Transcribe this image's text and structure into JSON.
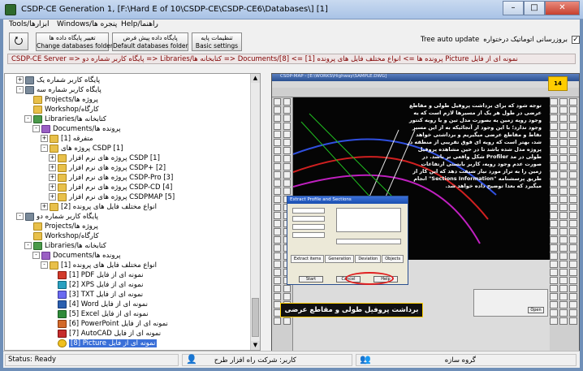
{
  "window": {
    "title": "CSDP-CE Generation 1, [F:\\Hard E of 10\\CSDP-CE\\CSDP-CE6\\Databases\\] [1]",
    "min_label": "–",
    "max_label": "□",
    "close_label": "✕"
  },
  "menu": {
    "items": [
      "Tools/ابزارها",
      "Windows/پنجره ها",
      "Help/راهنما"
    ]
  },
  "toolbar": {
    "icon_button": "⭮",
    "buttons": [
      {
        "line1": "تغییر پایگاه داده ها",
        "line2": "Change databases folder"
      },
      {
        "line1": "پایگاه داده پیش فرض",
        "line2": "Default databases folder"
      },
      {
        "line1": "تنظیمات پایه",
        "line2": "Basic settings"
      }
    ],
    "tree_auto_update_label": "Tree auto update",
    "tree_auto_update_check": "✓",
    "auto_update_label": "بروزرسانی اتوماتیک درختواره",
    "auto_update_check": "✓"
  },
  "path_text": "CSDP-CE Server => پایگاه کاربر شماره دو => Libraries/کتابخانه ها => Documents/پرونده ها => انواع مختلف فایل های پرونده [1] => [8] Picture نمونه ای از فایل",
  "tree": [
    {
      "label": "پایگاه کاربر شماره یک",
      "expander": "+",
      "icon": "server",
      "indent": 2
    },
    {
      "label": "پایگاه کاربر شماره سه",
      "expander": "-",
      "icon": "server",
      "indent": 2
    },
    {
      "label": "Projects/پروژه ها",
      "expander": "",
      "icon": "folder",
      "indent": 3
    },
    {
      "label": "Workshop/کارگاه",
      "expander": "",
      "icon": "folder",
      "indent": 3
    },
    {
      "label": "Libraries/کتابخانه ها",
      "expander": "-",
      "icon": "lib",
      "indent": 3
    },
    {
      "label": "Documents/پرونده ها",
      "expander": "-",
      "icon": "purple",
      "indent": 4
    },
    {
      "label": "متفرقه [1]",
      "expander": "+",
      "icon": "folder",
      "indent": 5
    },
    {
      "label": "پروژه های CSDP [1]",
      "expander": "-",
      "icon": "folder",
      "indent": 5
    },
    {
      "label": "پروژه های نرم افزار CSDP [1]",
      "expander": "+",
      "icon": "folder",
      "indent": 6
    },
    {
      "label": "پروژه های نرم افزار CSDP+ [2]",
      "expander": "+",
      "icon": "folder",
      "indent": 6
    },
    {
      "label": "پروژه های نرم افزار CSDP-Pro [3]",
      "expander": "+",
      "icon": "folder",
      "indent": 6
    },
    {
      "label": "پروژه های نرم افزار CSDP-CD [4]",
      "expander": "+",
      "icon": "folder",
      "indent": 6
    },
    {
      "label": "پروژه های نرم افزار CSDPMAP [5]",
      "expander": "+",
      "icon": "folder",
      "indent": 6
    },
    {
      "label": "انواع مختلف فایل های پرونده [2]",
      "expander": "+",
      "icon": "folder",
      "indent": 5
    },
    {
      "label": "پایگاه کاربر شماره دو",
      "expander": "-",
      "icon": "server",
      "indent": 2
    },
    {
      "label": "Projects/پروژه ها",
      "expander": "",
      "icon": "folder",
      "indent": 3
    },
    {
      "label": "Workshop/کارگاه",
      "expander": "",
      "icon": "folder",
      "indent": 3
    },
    {
      "label": "Libraries/کتابخانه ها",
      "expander": "-",
      "icon": "lib",
      "indent": 3
    },
    {
      "label": "Documents/پرونده ها",
      "expander": "-",
      "icon": "purple",
      "indent": 4
    },
    {
      "label": "انواع مختلف فایل های پرونده [1]",
      "expander": "-",
      "icon": "folder",
      "indent": 5
    },
    {
      "label": "[1] PDF نمونه ای از فایل",
      "expander": "",
      "icon": "pdf",
      "indent": 6
    },
    {
      "label": "[2] XPS نمونه ای از فایل",
      "expander": "",
      "icon": "xps",
      "indent": 6
    },
    {
      "label": "[3] TXT نمونه ای از فایل",
      "expander": "",
      "icon": "txt",
      "indent": 6
    },
    {
      "label": "[4] Word نمونه ای از فایل",
      "expander": "",
      "icon": "word",
      "indent": 6
    },
    {
      "label": "[5] Excel نمونه ای از فایل",
      "expander": "",
      "icon": "excel",
      "indent": 6
    },
    {
      "label": "[6] PowerPoint نمونه ای از فایل",
      "expander": "",
      "icon": "ppt",
      "indent": 6
    },
    {
      "label": "[7] AutoCAD نمونه ای از فایل",
      "expander": "",
      "icon": "cad",
      "indent": 6
    },
    {
      "label": "[8] Picture نمونه ای از فایل",
      "expander": "",
      "icon": "pic",
      "indent": 6,
      "selected": true
    }
  ],
  "preview": {
    "badge": "14",
    "description": "توجه شود که برای برداشت پروفیل طولی و مقاطع عرضی در طول هر یک از مسیرها لازم است که یه وجود رویه زمین یه بصورت مدل تین و یا رویه کنتور وجود ندارد؛ با این وجود از آنجائیکه به از این مسیر نقاط و مقاطع عرضی میگیریم و برداشتی خواهد شد، بهتر است که رویه ای فوق تقریبی از منطقه در پروژه مدل شده باشد تا در حین مشاهده پروفیل طولی در مد Profiler شکل واقعی تر باشد. در صورت عدم وجود رویه، کاربر بایستی ارتفاعات زمین را به تراز مورد نیاز شیفت دهد که این کار از طریق پرسشنامه \"Sections Information\" انجام میگیرد که بعدا توضیح داده خواهد شد.",
    "dialog_title": "Extract Profile and Sections",
    "dialog_tabs": [
      "Extract items",
      "Generation",
      "Deviation",
      "Objects"
    ],
    "dialog_buttons": [
      "Start",
      "Cancel",
      "Help"
    ],
    "banner": "برداشت پروفیل طولی و مقاطع عرضی",
    "open_button": "Open"
  },
  "status": {
    "ready": "Status: Ready",
    "user_label": "کاربر: شرکت راه افزار طرح",
    "group_label": "گروه سازه",
    "user_icon": "👤",
    "group_icon": "👥"
  }
}
